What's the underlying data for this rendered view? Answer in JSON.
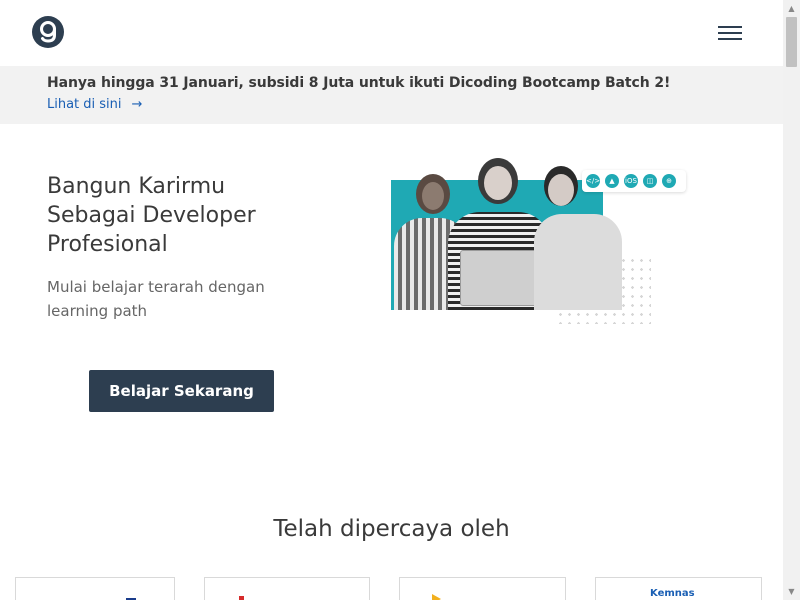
{
  "header": {
    "logo_icon": "dicoding-logo-icon",
    "menu_icon": "hamburger-menu-icon"
  },
  "promo": {
    "text": "Hanya hingga 31 Januari, subsidi 8 Juta untuk ikuti Dicoding Bootcamp Batch 2!",
    "link_label": "Lihat di sini",
    "link_icon": "arrow-right-icon",
    "link_arrow": "→"
  },
  "hero": {
    "title_lines": [
      "Bangun Karirmu",
      "Sebagai Developer",
      "Profesional"
    ],
    "subtitle": "Mulai belajar terarah dengan learning path",
    "cta_label": "Belajar Sekarang",
    "tech_icons": [
      "code-icon",
      "android-icon",
      "ios-icon",
      "cloud-icon",
      "web-icon"
    ],
    "tech_icon_glyphs": [
      "</>",
      "▲",
      "iOS",
      "◫",
      "⊕"
    ]
  },
  "trust": {
    "title": "Telah dipercaya oleh",
    "partners": [
      {
        "logo": ""
      },
      {
        "logo": ""
      },
      {
        "logo": ""
      },
      {
        "logo": "Kemnas"
      }
    ]
  },
  "colors": {
    "brand_dark": "#2d3e50",
    "accent_teal": "#1fa9b4",
    "link_blue": "#1a5fb4",
    "banner_bg": "#f2f2f2"
  }
}
